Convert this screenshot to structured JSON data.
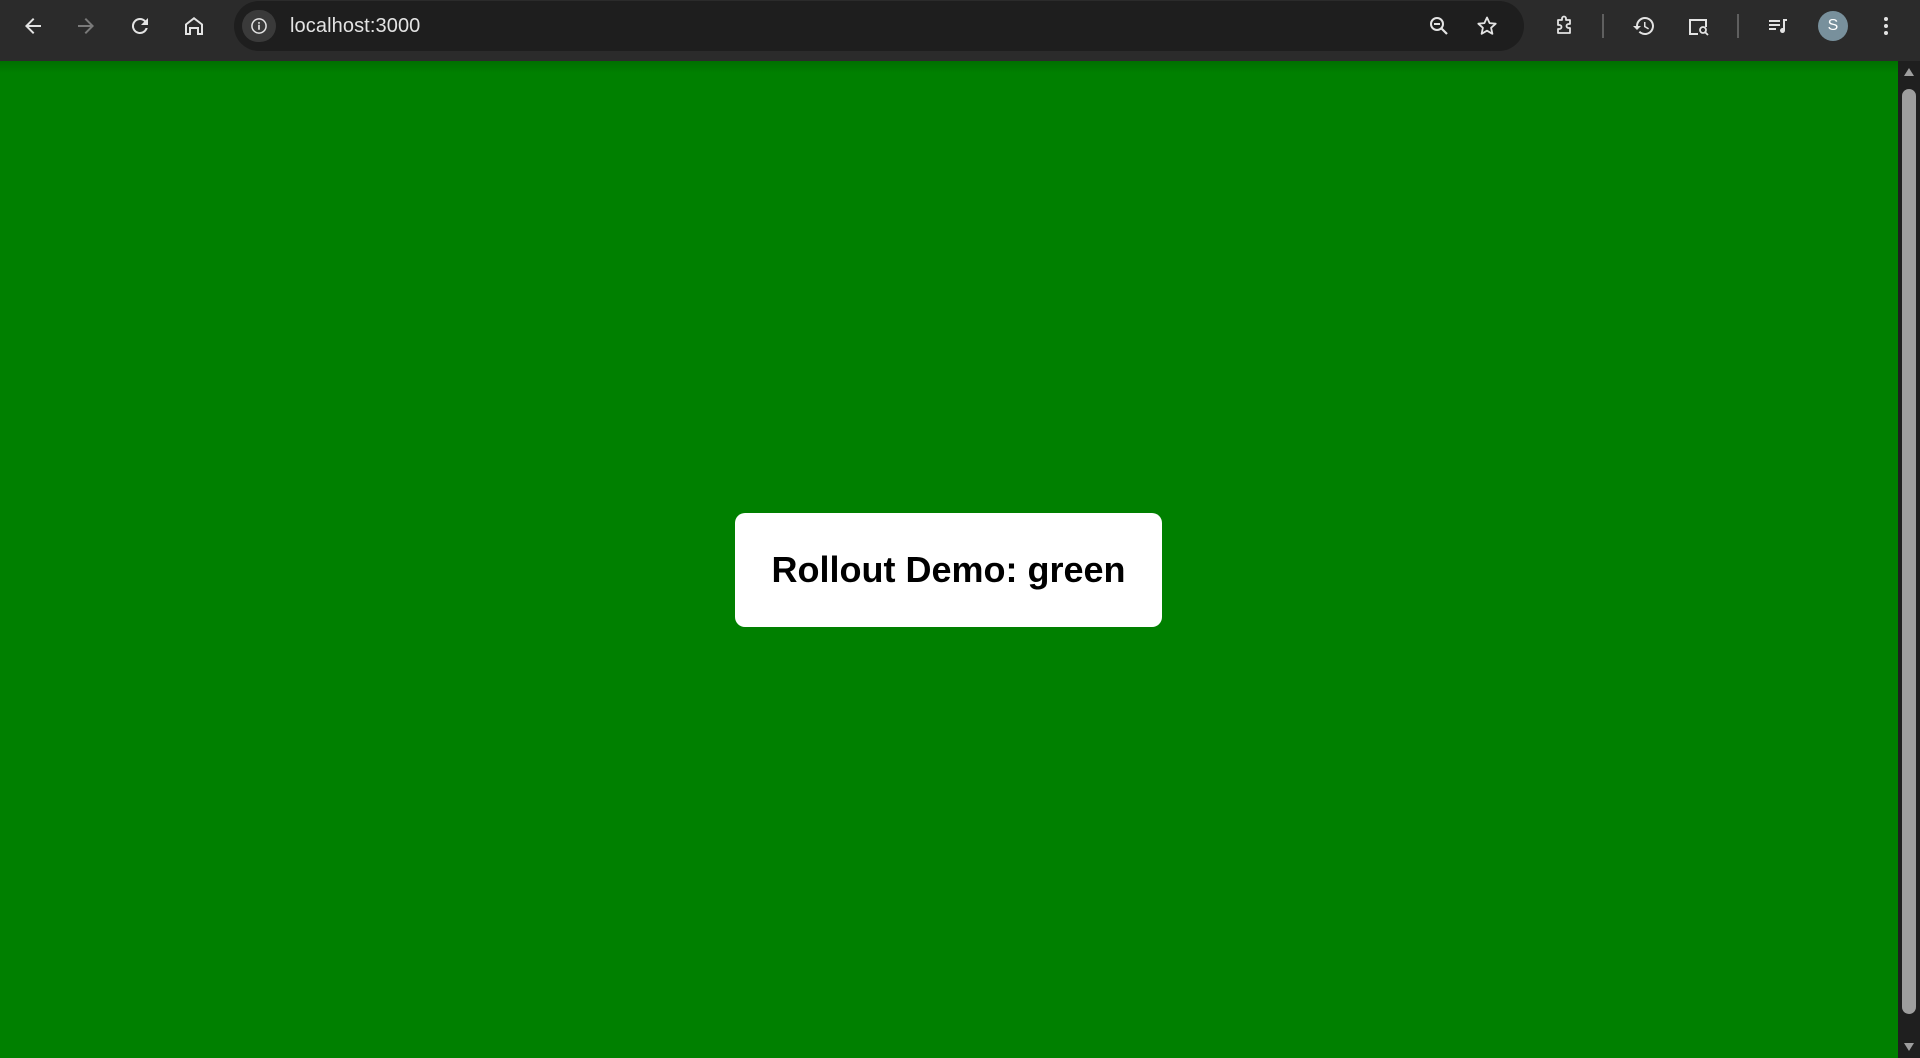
{
  "browser": {
    "url": "localhost:3000",
    "profile_initial": "S",
    "icons": {
      "back": "back-arrow-icon",
      "forward": "forward-arrow-icon",
      "reload": "reload-icon",
      "home": "home-icon",
      "site_info": "info-icon",
      "zoom": "zoom-out-icon",
      "bookmark": "star-icon",
      "extensions": "puzzle-icon",
      "history": "history-icon",
      "search_tab": "tab-search-icon",
      "media": "media-playlist-icon",
      "menu": "kebab-menu-icon"
    }
  },
  "page": {
    "background_color": "#008000",
    "heading": "Rollout Demo: green"
  }
}
